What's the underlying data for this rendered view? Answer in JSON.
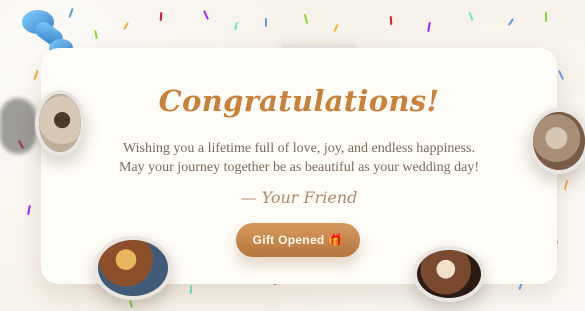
{
  "card": {
    "title": "Congratulations!",
    "message": "Wishing you a lifetime full of love, joy, and endless happiness. May your journey together be as beautiful as your wedding day!",
    "signature": "— Your Friend",
    "button_label": "Gift Opened 🎁"
  },
  "decor": {
    "pin_icon": "thumbtack-icon",
    "confetti_colors": [
      "#4a90e2",
      "#7ed321",
      "#f5a623",
      "#d0021b",
      "#9013fe",
      "#50e3c2"
    ]
  }
}
